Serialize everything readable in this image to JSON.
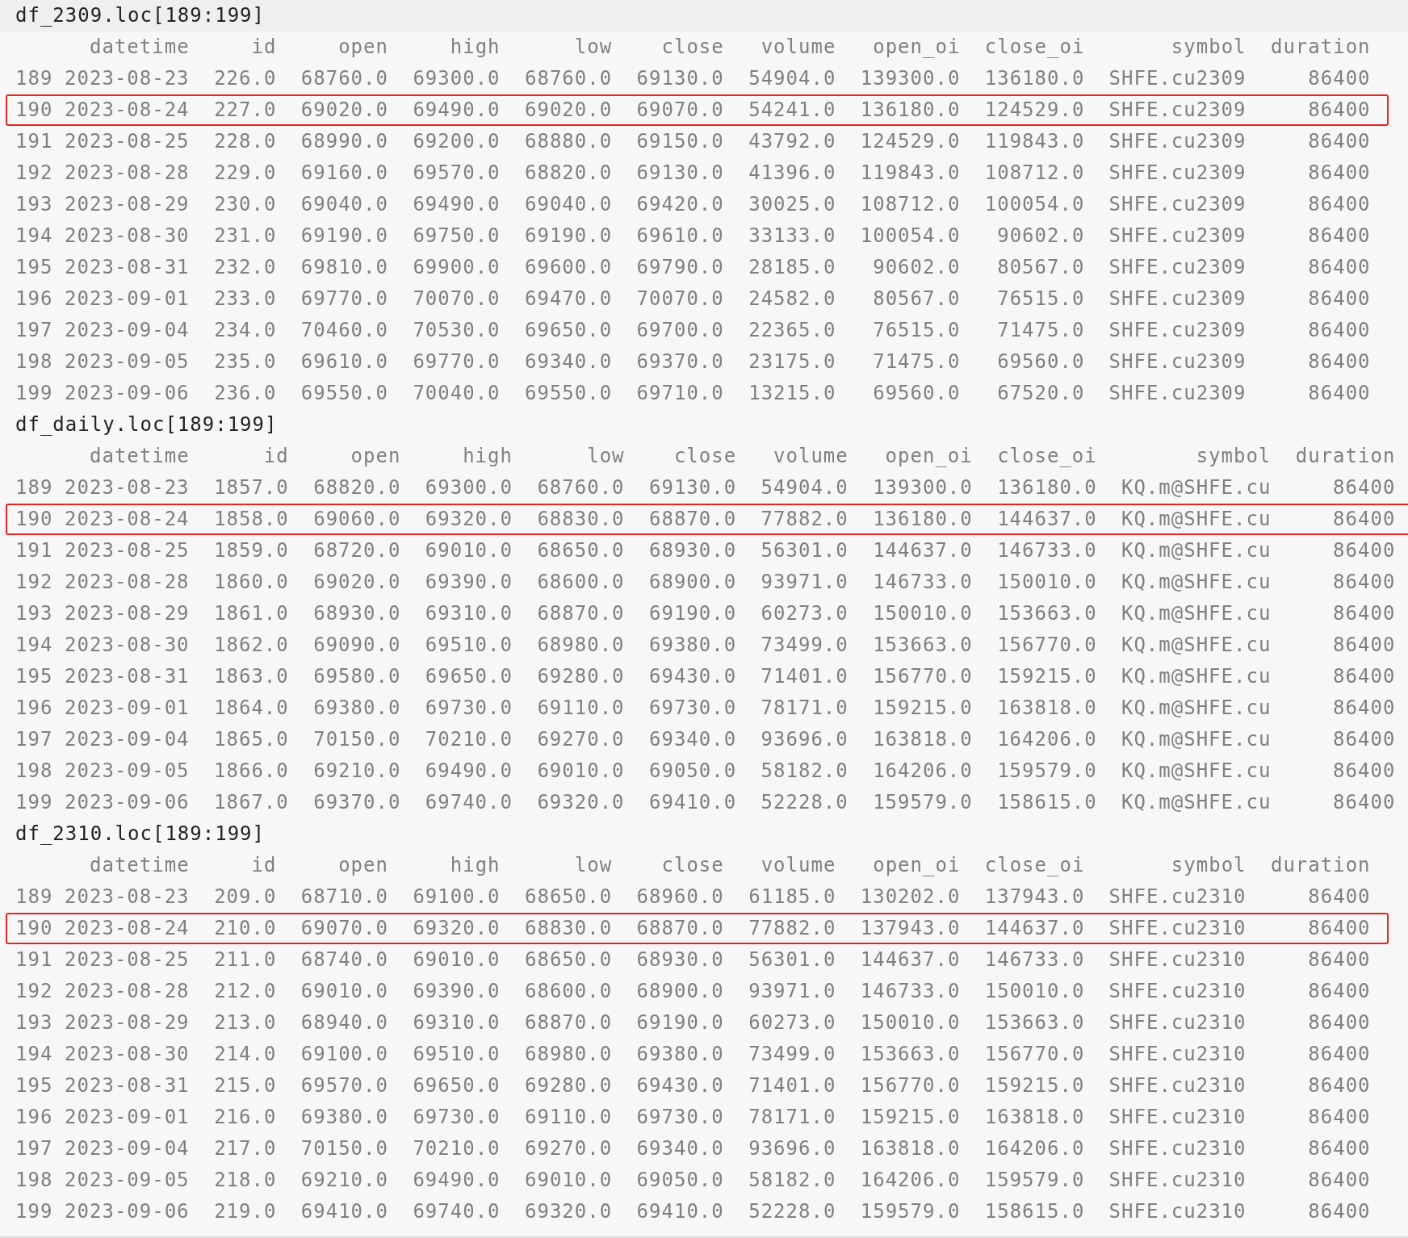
{
  "blocks": [
    {
      "title": "df_2309.loc[189:199]",
      "columns": [
        "datetime",
        "id",
        "open",
        "high",
        "low",
        "close",
        "volume",
        "open_oi",
        "close_oi",
        "symbol",
        "duration"
      ],
      "rows": [
        {
          "index": "189",
          "highlighted": false,
          "cells": [
            "2023-08-23",
            "226.0",
            "68760.0",
            "69300.0",
            "68760.0",
            "69130.0",
            "54904.0",
            "139300.0",
            "136180.0",
            "SHFE.cu2309",
            "86400"
          ]
        },
        {
          "index": "190",
          "highlighted": true,
          "cells": [
            "2023-08-24",
            "227.0",
            "69020.0",
            "69490.0",
            "69020.0",
            "69070.0",
            "54241.0",
            "136180.0",
            "124529.0",
            "SHFE.cu2309",
            "86400"
          ]
        },
        {
          "index": "191",
          "highlighted": false,
          "cells": [
            "2023-08-25",
            "228.0",
            "68990.0",
            "69200.0",
            "68880.0",
            "69150.0",
            "43792.0",
            "124529.0",
            "119843.0",
            "SHFE.cu2309",
            "86400"
          ]
        },
        {
          "index": "192",
          "highlighted": false,
          "cells": [
            "2023-08-28",
            "229.0",
            "69160.0",
            "69570.0",
            "68820.0",
            "69130.0",
            "41396.0",
            "119843.0",
            "108712.0",
            "SHFE.cu2309",
            "86400"
          ]
        },
        {
          "index": "193",
          "highlighted": false,
          "cells": [
            "2023-08-29",
            "230.0",
            "69040.0",
            "69490.0",
            "69040.0",
            "69420.0",
            "30025.0",
            "108712.0",
            "100054.0",
            "SHFE.cu2309",
            "86400"
          ]
        },
        {
          "index": "194",
          "highlighted": false,
          "cells": [
            "2023-08-30",
            "231.0",
            "69190.0",
            "69750.0",
            "69190.0",
            "69610.0",
            "33133.0",
            "100054.0",
            "90602.0",
            "SHFE.cu2309",
            "86400"
          ]
        },
        {
          "index": "195",
          "highlighted": false,
          "cells": [
            "2023-08-31",
            "232.0",
            "69810.0",
            "69900.0",
            "69600.0",
            "69790.0",
            "28185.0",
            "90602.0",
            "80567.0",
            "SHFE.cu2309",
            "86400"
          ]
        },
        {
          "index": "196",
          "highlighted": false,
          "cells": [
            "2023-09-01",
            "233.0",
            "69770.0",
            "70070.0",
            "69470.0",
            "70070.0",
            "24582.0",
            "80567.0",
            "76515.0",
            "SHFE.cu2309",
            "86400"
          ]
        },
        {
          "index": "197",
          "highlighted": false,
          "cells": [
            "2023-09-04",
            "234.0",
            "70460.0",
            "70530.0",
            "69650.0",
            "69700.0",
            "22365.0",
            "76515.0",
            "71475.0",
            "SHFE.cu2309",
            "86400"
          ]
        },
        {
          "index": "198",
          "highlighted": false,
          "cells": [
            "2023-09-05",
            "235.0",
            "69610.0",
            "69770.0",
            "69340.0",
            "69370.0",
            "23175.0",
            "71475.0",
            "69560.0",
            "SHFE.cu2309",
            "86400"
          ]
        },
        {
          "index": "199",
          "highlighted": false,
          "cells": [
            "2023-09-06",
            "236.0",
            "69550.0",
            "70040.0",
            "69550.0",
            "69710.0",
            "13215.0",
            "69560.0",
            "67520.0",
            "SHFE.cu2309",
            "86400"
          ]
        }
      ]
    },
    {
      "title": "df_daily.loc[189:199]",
      "columns": [
        "datetime",
        "id",
        "open",
        "high",
        "low",
        "close",
        "volume",
        "open_oi",
        "close_oi",
        "symbol",
        "duration"
      ],
      "rows": [
        {
          "index": "189",
          "highlighted": false,
          "cells": [
            "2023-08-23",
            "1857.0",
            "68820.0",
            "69300.0",
            "68760.0",
            "69130.0",
            "54904.0",
            "139300.0",
            "136180.0",
            "KQ.m@SHFE.cu",
            "86400"
          ]
        },
        {
          "index": "190",
          "highlighted": true,
          "cells": [
            "2023-08-24",
            "1858.0",
            "69060.0",
            "69320.0",
            "68830.0",
            "68870.0",
            "77882.0",
            "136180.0",
            "144637.0",
            "KQ.m@SHFE.cu",
            "86400"
          ]
        },
        {
          "index": "191",
          "highlighted": false,
          "cells": [
            "2023-08-25",
            "1859.0",
            "68720.0",
            "69010.0",
            "68650.0",
            "68930.0",
            "56301.0",
            "144637.0",
            "146733.0",
            "KQ.m@SHFE.cu",
            "86400"
          ]
        },
        {
          "index": "192",
          "highlighted": false,
          "cells": [
            "2023-08-28",
            "1860.0",
            "69020.0",
            "69390.0",
            "68600.0",
            "68900.0",
            "93971.0",
            "146733.0",
            "150010.0",
            "KQ.m@SHFE.cu",
            "86400"
          ]
        },
        {
          "index": "193",
          "highlighted": false,
          "cells": [
            "2023-08-29",
            "1861.0",
            "68930.0",
            "69310.0",
            "68870.0",
            "69190.0",
            "60273.0",
            "150010.0",
            "153663.0",
            "KQ.m@SHFE.cu",
            "86400"
          ]
        },
        {
          "index": "194",
          "highlighted": false,
          "cells": [
            "2023-08-30",
            "1862.0",
            "69090.0",
            "69510.0",
            "68980.0",
            "69380.0",
            "73499.0",
            "153663.0",
            "156770.0",
            "KQ.m@SHFE.cu",
            "86400"
          ]
        },
        {
          "index": "195",
          "highlighted": false,
          "cells": [
            "2023-08-31",
            "1863.0",
            "69580.0",
            "69650.0",
            "69280.0",
            "69430.0",
            "71401.0",
            "156770.0",
            "159215.0",
            "KQ.m@SHFE.cu",
            "86400"
          ]
        },
        {
          "index": "196",
          "highlighted": false,
          "cells": [
            "2023-09-01",
            "1864.0",
            "69380.0",
            "69730.0",
            "69110.0",
            "69730.0",
            "78171.0",
            "159215.0",
            "163818.0",
            "KQ.m@SHFE.cu",
            "86400"
          ]
        },
        {
          "index": "197",
          "highlighted": false,
          "cells": [
            "2023-09-04",
            "1865.0",
            "70150.0",
            "70210.0",
            "69270.0",
            "69340.0",
            "93696.0",
            "163818.0",
            "164206.0",
            "KQ.m@SHFE.cu",
            "86400"
          ]
        },
        {
          "index": "198",
          "highlighted": false,
          "cells": [
            "2023-09-05",
            "1866.0",
            "69210.0",
            "69490.0",
            "69010.0",
            "69050.0",
            "58182.0",
            "164206.0",
            "159579.0",
            "KQ.m@SHFE.cu",
            "86400"
          ]
        },
        {
          "index": "199",
          "highlighted": false,
          "cells": [
            "2023-09-06",
            "1867.0",
            "69370.0",
            "69740.0",
            "69320.0",
            "69410.0",
            "52228.0",
            "159579.0",
            "158615.0",
            "KQ.m@SHFE.cu",
            "86400"
          ]
        }
      ]
    },
    {
      "title": "df_2310.loc[189:199]",
      "columns": [
        "datetime",
        "id",
        "open",
        "high",
        "low",
        "close",
        "volume",
        "open_oi",
        "close_oi",
        "symbol",
        "duration"
      ],
      "rows": [
        {
          "index": "189",
          "highlighted": false,
          "cells": [
            "2023-08-23",
            "209.0",
            "68710.0",
            "69100.0",
            "68650.0",
            "68960.0",
            "61185.0",
            "130202.0",
            "137943.0",
            "SHFE.cu2310",
            "86400"
          ]
        },
        {
          "index": "190",
          "highlighted": true,
          "cells": [
            "2023-08-24",
            "210.0",
            "69070.0",
            "69320.0",
            "68830.0",
            "68870.0",
            "77882.0",
            "137943.0",
            "144637.0",
            "SHFE.cu2310",
            "86400"
          ]
        },
        {
          "index": "191",
          "highlighted": false,
          "cells": [
            "2023-08-25",
            "211.0",
            "68740.0",
            "69010.0",
            "68650.0",
            "68930.0",
            "56301.0",
            "144637.0",
            "146733.0",
            "SHFE.cu2310",
            "86400"
          ]
        },
        {
          "index": "192",
          "highlighted": false,
          "cells": [
            "2023-08-28",
            "212.0",
            "69010.0",
            "69390.0",
            "68600.0",
            "68900.0",
            "93971.0",
            "146733.0",
            "150010.0",
            "SHFE.cu2310",
            "86400"
          ]
        },
        {
          "index": "193",
          "highlighted": false,
          "cells": [
            "2023-08-29",
            "213.0",
            "68940.0",
            "69310.0",
            "68870.0",
            "69190.0",
            "60273.0",
            "150010.0",
            "153663.0",
            "SHFE.cu2310",
            "86400"
          ]
        },
        {
          "index": "194",
          "highlighted": false,
          "cells": [
            "2023-08-30",
            "214.0",
            "69100.0",
            "69510.0",
            "68980.0",
            "69380.0",
            "73499.0",
            "153663.0",
            "156770.0",
            "SHFE.cu2310",
            "86400"
          ]
        },
        {
          "index": "195",
          "highlighted": false,
          "cells": [
            "2023-08-31",
            "215.0",
            "69570.0",
            "69650.0",
            "69280.0",
            "69430.0",
            "71401.0",
            "156770.0",
            "159215.0",
            "SHFE.cu2310",
            "86400"
          ]
        },
        {
          "index": "196",
          "highlighted": false,
          "cells": [
            "2023-09-01",
            "216.0",
            "69380.0",
            "69730.0",
            "69110.0",
            "69730.0",
            "78171.0",
            "159215.0",
            "163818.0",
            "SHFE.cu2310",
            "86400"
          ]
        },
        {
          "index": "197",
          "highlighted": false,
          "cells": [
            "2023-09-04",
            "217.0",
            "70150.0",
            "70210.0",
            "69270.0",
            "69340.0",
            "93696.0",
            "163818.0",
            "164206.0",
            "SHFE.cu2310",
            "86400"
          ]
        },
        {
          "index": "198",
          "highlighted": false,
          "cells": [
            "2023-09-05",
            "218.0",
            "69210.0",
            "69490.0",
            "69010.0",
            "69050.0",
            "58182.0",
            "164206.0",
            "159579.0",
            "SHFE.cu2310",
            "86400"
          ]
        },
        {
          "index": "199",
          "highlighted": false,
          "cells": [
            "2023-09-06",
            "219.0",
            "69410.0",
            "69740.0",
            "69320.0",
            "69410.0",
            "52228.0",
            "159579.0",
            "158615.0",
            "SHFE.cu2310",
            "86400"
          ]
        }
      ]
    }
  ]
}
